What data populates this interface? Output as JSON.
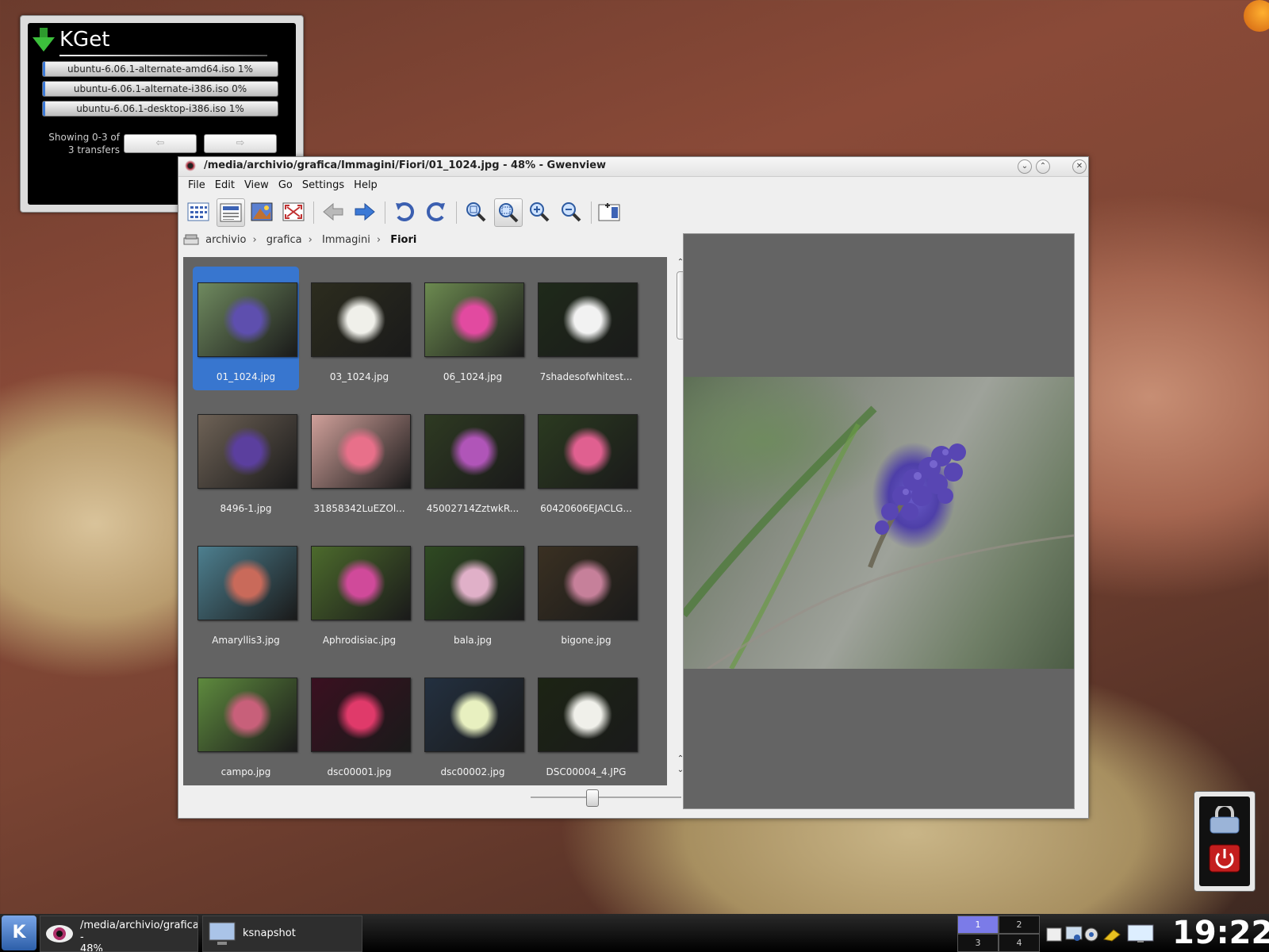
{
  "kget": {
    "title": "KGet",
    "transfers": [
      {
        "label": "ubuntu-6.06.1-alternate-amd64.iso 1%",
        "progress": 0.01
      },
      {
        "label": "ubuntu-6.06.1-alternate-i386.iso 0%",
        "progress": 0.0
      },
      {
        "label": "ubuntu-6.06.1-desktop-i386.iso 1%",
        "progress": 0.01
      }
    ],
    "showing": "Showing 0-3 of 3 transfers",
    "prev_glyph": "⇦",
    "next_glyph": "⇨"
  },
  "window": {
    "title": "/media/archivio/grafica/Immagini/Fiori/01_1024.jpg - 48% - Gwenview",
    "menu": [
      "File",
      "Edit",
      "View",
      "Go",
      "Settings",
      "Help"
    ],
    "breadcrumb": [
      "archivio",
      "grafica",
      "Immagini",
      "Fiori"
    ],
    "thumbnails": [
      {
        "name": "01_1024.jpg",
        "selected": true,
        "colors": [
          "#6f8a5f",
          "#5e4fae"
        ]
      },
      {
        "name": "03_1024.jpg",
        "colors": [
          "#2c2c1e",
          "#f0f0ea"
        ]
      },
      {
        "name": "06_1024.jpg",
        "colors": [
          "#6c8a50",
          "#e24aa0"
        ]
      },
      {
        "name": "7shadesofwhitest...",
        "colors": [
          "#1f2a1a",
          "#f2f2f2"
        ]
      },
      {
        "name": "8496-1.jpg",
        "colors": [
          "#6e6256",
          "#5b3f9e"
        ]
      },
      {
        "name": "31858342LuEZOl...",
        "colors": [
          "#d0a09a",
          "#e8708a"
        ]
      },
      {
        "name": "45002714ZztwkR...",
        "colors": [
          "#2e3a22",
          "#b055b8"
        ]
      },
      {
        "name": "60420606EJACLG...",
        "colors": [
          "#2b3a20",
          "#e06090"
        ]
      },
      {
        "name": "Amaryllis3.jpg",
        "colors": [
          "#4d7f8f",
          "#c96a5a"
        ]
      },
      {
        "name": "Aphrodisiac.jpg",
        "colors": [
          "#4c6a2c",
          "#d04a9a"
        ]
      },
      {
        "name": "bala.jpg",
        "colors": [
          "#2f4a22",
          "#e0b0c8"
        ]
      },
      {
        "name": "bigone.jpg",
        "colors": [
          "#3a3022",
          "#c6809a"
        ]
      },
      {
        "name": "campo.jpg",
        "colors": [
          "#5e8a3e",
          "#c8607a"
        ]
      },
      {
        "name": "dsc00001.jpg",
        "colors": [
          "#3a1020",
          "#e03a6a"
        ]
      },
      {
        "name": "dsc00002.jpg",
        "colors": [
          "#233040",
          "#e8f0c0"
        ]
      },
      {
        "name": "DSC00004_4.JPG",
        "colors": [
          "#1c2414",
          "#f0f0ea"
        ]
      }
    ]
  },
  "taskbar": {
    "tasks": [
      {
        "label": "/media/archivio/grafica\n-\n48%"
      },
      {
        "label": "ksnapshot"
      }
    ],
    "pager": [
      "1",
      "2",
      "3",
      "4"
    ],
    "clock": "19:22"
  }
}
